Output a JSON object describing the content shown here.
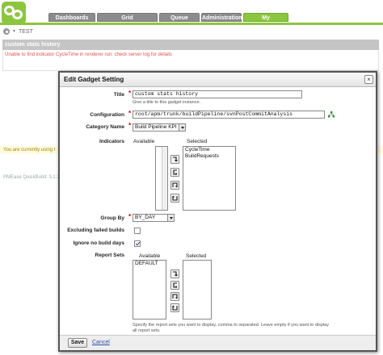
{
  "tabs": [
    {
      "label": "Dashboards",
      "active": false
    },
    {
      "label": "Grid",
      "active": false
    },
    {
      "label": "Queue",
      "active": false
    },
    {
      "label": "Administration",
      "active": false
    },
    {
      "label": "My",
      "active": true
    }
  ],
  "breadcrumb": {
    "label": "TEST"
  },
  "gadget": {
    "title": "custom stats history",
    "error": "Unable to find indicator CycleTime in renderer run: check server log for details"
  },
  "warning": "You are currently using t",
  "footer": "PMEase QuickBuild: 3.1.3, 20",
  "dialog": {
    "title": "Edit Gadget Setting",
    "fields": {
      "title": {
        "label": "Title",
        "value": "custom stats history",
        "hint": "Give a title to this gadget instance."
      },
      "configuration": {
        "label": "Configuration",
        "value": "root/apm/trunk/buildPipeline/svnPostCommitAnalysis"
      },
      "category": {
        "label": "Category Name",
        "value": "Build Pipeline KPI"
      },
      "indicators": {
        "label": "Indicators",
        "available_header": "Available",
        "selected_header": "Selected",
        "available": [],
        "selected": [
          "CycleTime",
          "BuildRequests"
        ]
      },
      "group_by": {
        "label": "Group By",
        "value": "BY_DAY"
      },
      "excluding_failed": {
        "label": "Excluding failed builds",
        "checked": false
      },
      "ignore_no_build_days": {
        "label": "Ignore no build days",
        "checked": true
      },
      "report_sets": {
        "label": "Report Sets",
        "available_header": "Available",
        "selected_header": "Selected",
        "available": [
          "DEFAULT"
        ],
        "selected": [],
        "hint": "Specify the report sets you want to display, comma to separated. Leave empty if you want to display all report sets."
      }
    },
    "buttons": {
      "save": "Save",
      "cancel": "Cancel"
    }
  },
  "colors": {
    "brand_green": "#8cc63f",
    "tab_gray": "#8c8c8c",
    "error_red": "#e0524f",
    "link_blue": "#2a4fa8"
  }
}
